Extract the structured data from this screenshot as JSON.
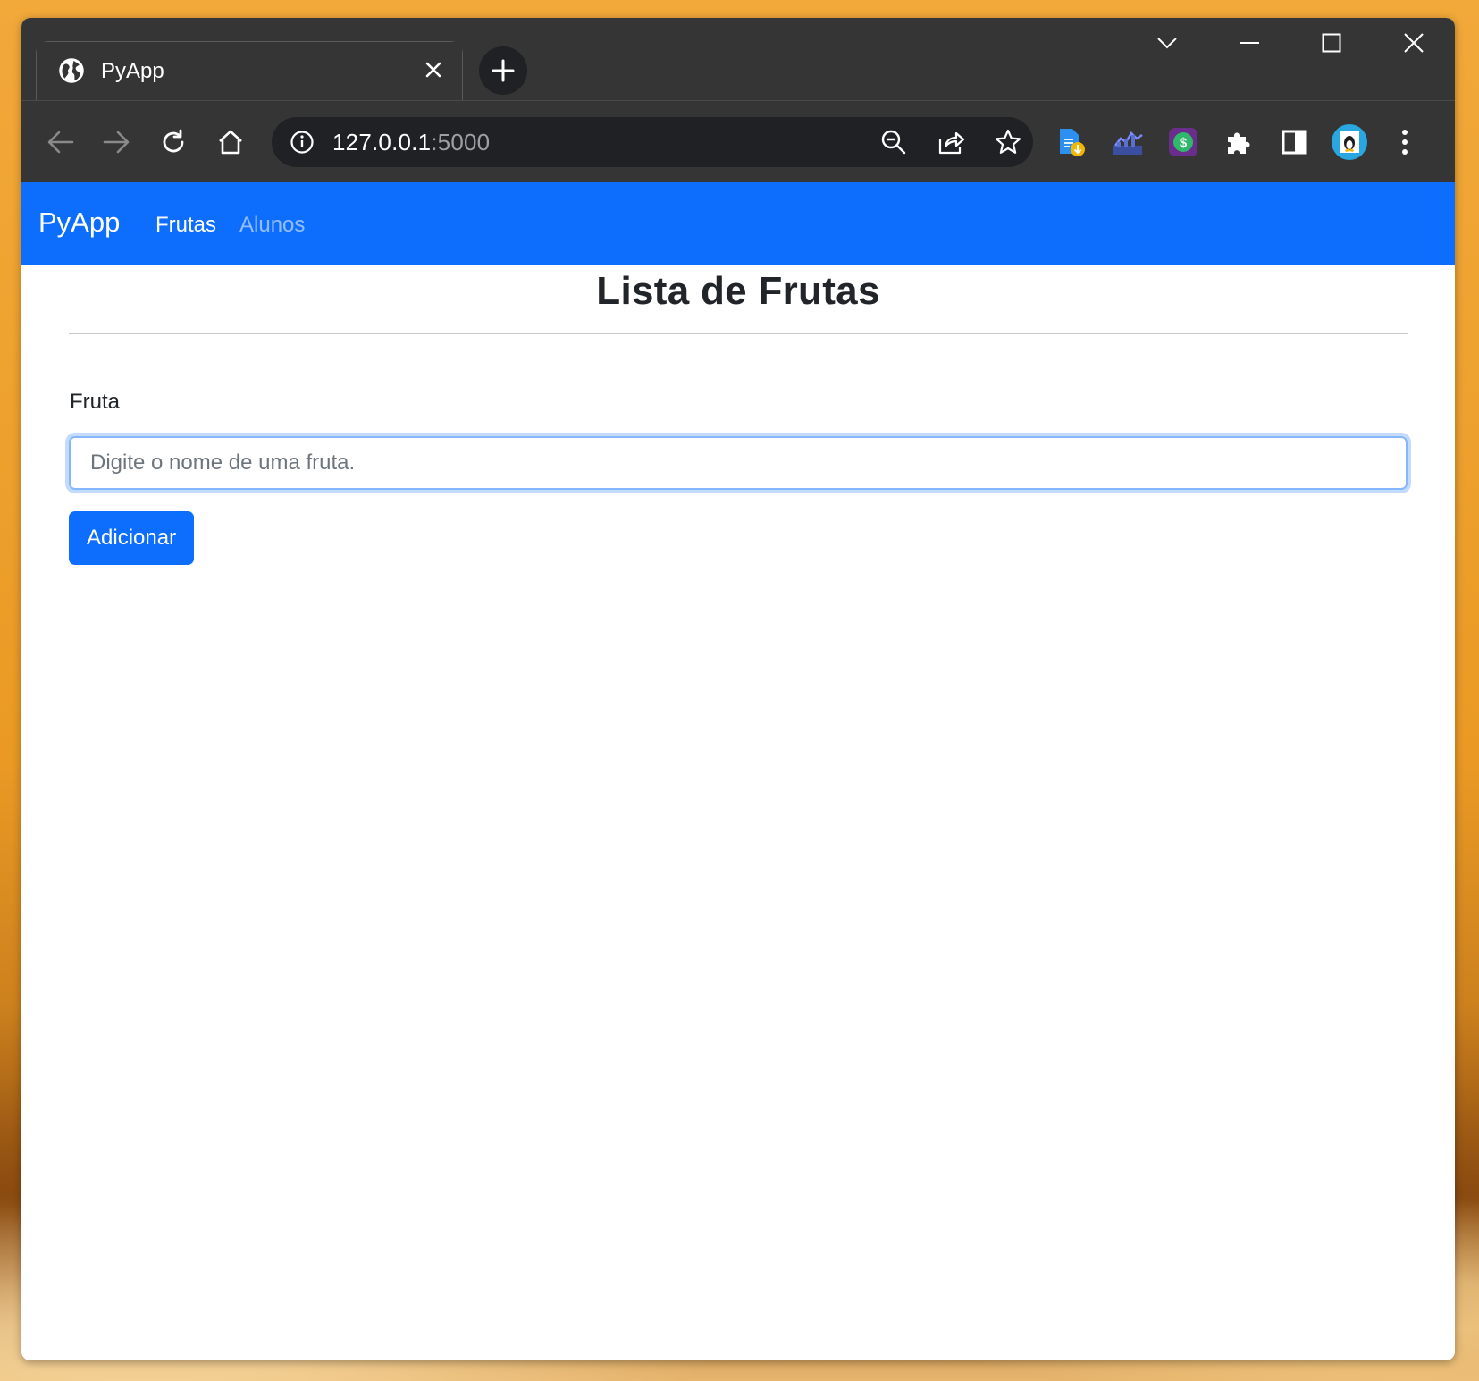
{
  "browser": {
    "tab": {
      "title": "PyApp",
      "favicon": "globe-icon"
    },
    "address": {
      "host": "127.0.0.1",
      "port": ":5000"
    },
    "extensions": [
      "file-download-extension-icon",
      "chart-extension-icon",
      "dollar-extension-icon",
      "puzzle-icon",
      "side-panel-icon",
      "profile-avatar"
    ]
  },
  "navbar": {
    "brand": "PyApp",
    "links": [
      {
        "label": "Frutas",
        "active": true
      },
      {
        "label": "Alunos",
        "active": false
      }
    ]
  },
  "main": {
    "title": "Lista de Frutas",
    "form": {
      "label": "Fruta",
      "placeholder": "Digite o nome de uma fruta.",
      "value": "",
      "submit_label": "Adicionar"
    }
  },
  "colors": {
    "primary": "#0d6efd",
    "chrome_dark": "#353535",
    "omnibox": "#202124"
  }
}
